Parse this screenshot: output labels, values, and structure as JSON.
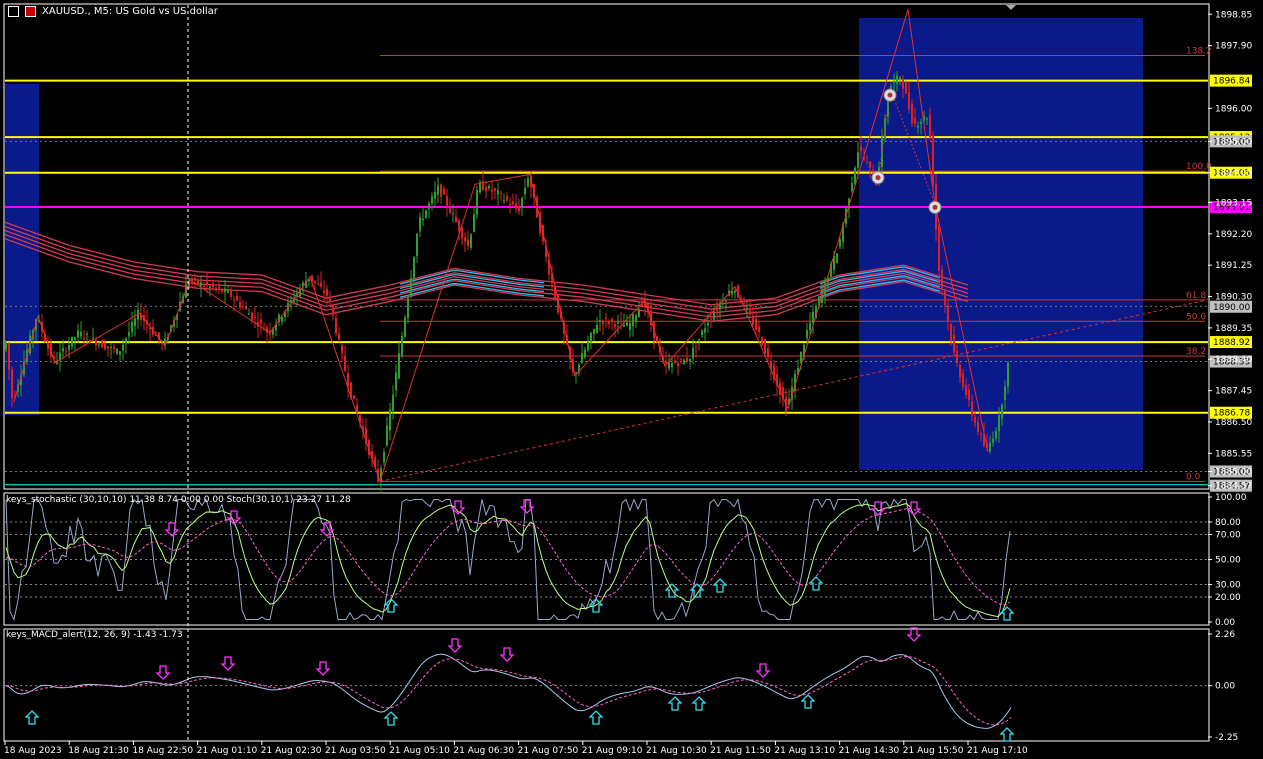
{
  "header": {
    "symbol_title": "XAUUSD., M5: US Gold vs US dollar"
  },
  "colors": {
    "bull": "#2e9f2e",
    "bear": "#e02020",
    "hline_yellow": "#ffff00",
    "hline_magenta": "#ff00ff",
    "fib_line": "#c83c3c",
    "ma_red": "#d23b55",
    "ma_blue": "#33bbee",
    "zone_blue": "#0b1a8a",
    "grid": "#808080"
  },
  "main_chart": {
    "price_axis": {
      "min": 1884.5,
      "max": 1899.1,
      "ticks": [
        "1898.85",
        "1897.90",
        "1896.00",
        "1895.00",
        "1894.05",
        "1893.15",
        "1892.20",
        "1891.25",
        "1890.30",
        "1889.35",
        "1888.40",
        "1887.45",
        "1886.50",
        "1885.55",
        "1885.00",
        "1884.57"
      ]
    },
    "price_ticks_values": [
      1898.85,
      1897.9,
      1896.0,
      1895.0,
      1894.05,
      1893.15,
      1892.2,
      1891.25,
      1890.3,
      1889.35,
      1888.4,
      1887.45,
      1886.5,
      1885.55,
      1885.0,
      1884.57
    ],
    "horizontal_levels": [
      {
        "price": 1896.84,
        "label": "1896.84",
        "color": "#ffff00"
      },
      {
        "price": 1895.13,
        "label": "1895.13",
        "color": "#ffff00"
      },
      {
        "price": 1894.05,
        "label": "1894.05",
        "color": "#ffff00"
      },
      {
        "price": 1893.01,
        "label": "1893.01",
        "color": "#ff00ff"
      },
      {
        "price": 1888.92,
        "label": "1888.92",
        "color": "#ffff00"
      },
      {
        "price": 1886.78,
        "label": "1886.78",
        "color": "#ffff00"
      }
    ],
    "fib_levels": [
      {
        "price": 1897.6,
        "label": "138.2"
      },
      {
        "price": 1894.1,
        "label": "100.0"
      },
      {
        "price": 1890.2,
        "label": "61.8"
      },
      {
        "price": 1889.55,
        "label": "50.0"
      },
      {
        "price": 1888.5,
        "label": "38.2"
      },
      {
        "price": 1884.7,
        "label": "0.0"
      }
    ],
    "bid_ask_labels": [
      {
        "price": 1895.0,
        "label": "1895.00"
      },
      {
        "price": 1889.99,
        "label": "1890.00"
      },
      {
        "price": 1888.33,
        "label": "1888.33"
      },
      {
        "price": 1885.0,
        "label": "1885.00"
      },
      {
        "price": 1884.57,
        "label": "1884.57"
      }
    ]
  },
  "time_axis": {
    "labels": [
      "18 Aug 2023",
      "18 Aug 21:30",
      "18 Aug 22:50",
      "21 Aug 01:10",
      "21 Aug 02:30",
      "21 Aug 03:50",
      "21 Aug 05:10",
      "21 Aug 06:30",
      "21 Aug 07:50",
      "21 Aug 09:10",
      "21 Aug 10:30",
      "21 Aug 11:50",
      "21 Aug 13:10",
      "21 Aug 14:30",
      "21 Aug 15:50",
      "21 Aug 17:10"
    ]
  },
  "stochastic": {
    "header": "keys_stochastic (30,10,10) 11.38 8.74 0.00 0.00 Stoch(30,10,1) 23.27 11.28",
    "ticks": [
      "100.00",
      "80.00",
      "70.00",
      "50.00",
      "30.00",
      "20.00",
      "0.00"
    ],
    "tick_values": [
      100,
      80,
      70,
      50,
      30,
      20,
      0
    ]
  },
  "macd": {
    "header": "keys_MACD_alert(12, 26, 9) -1.43 -1.73",
    "ticks": [
      "2.26",
      "0.00",
      "-2.25"
    ],
    "tick_values": [
      2.26,
      0,
      -2.25
    ]
  },
  "chart_data": {
    "type": "line",
    "x": [
      "18 Aug 2023",
      "18 Aug 21:30",
      "18 Aug 22:50",
      "21 Aug 01:10",
      "21 Aug 02:30",
      "21 Aug 03:50",
      "21 Aug 05:10",
      "21 Aug 06:30",
      "21 Aug 07:50",
      "21 Aug 09:10",
      "21 Aug 10:30",
      "21 Aug 11:50",
      "21 Aug 13:10",
      "21 Aug 14:30",
      "21 Aug 15:50",
      "21 Aug 17:10"
    ],
    "series": [
      {
        "values": [
          1889.6,
          1888.6,
          1889.5,
          1890.7,
          1889.9,
          1885.4,
          1892.6,
          1893.3,
          1888.3,
          1889.7,
          1888.4,
          1889.3,
          1888.5,
          1897.1,
          1893.2,
          1888.7
        ]
      },
      {
        "values": [
          1892.3,
          1891.6,
          1891.1,
          1890.8,
          1890.7,
          1890.0,
          1890.4,
          1890.9,
          1890.6,
          1890.4,
          1890.1,
          1889.8,
          1890.0,
          1890.7,
          1891.0,
          1890.4
        ]
      }
    ],
    "ylim": [
      1884.5,
      1899.1
    ],
    "grid": true
  }
}
